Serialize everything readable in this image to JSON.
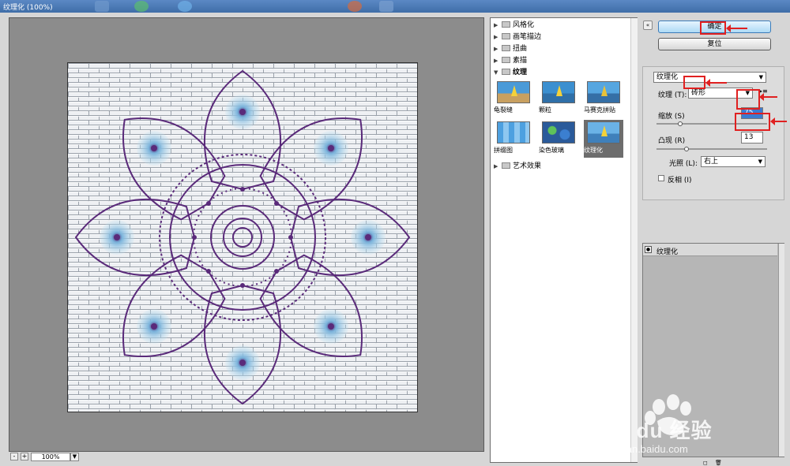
{
  "window": {
    "title": "纹理化 (100%)"
  },
  "preview": {
    "zoom": "100%",
    "minus": "-",
    "plus": "+"
  },
  "gallery": {
    "categories": [
      "风格化",
      "画笔描边",
      "扭曲",
      "素描",
      "纹理",
      "艺术效果"
    ],
    "texture_filters": [
      "龟裂缝",
      "颗粒",
      "马赛克拼贴",
      "拼缀图",
      "染色玻璃",
      "纹理化"
    ],
    "selected": "纹理化"
  },
  "settings": {
    "ok_label": "确定",
    "reset_label": "复位",
    "filter_select": "纹理化",
    "texture_label": "纹理 (T):",
    "texture_value": "砖形",
    "scaling_label": "缩放 (S)",
    "scaling_value": "75",
    "scaling_fraction": 0.2,
    "relief_label": "凸现 (R)",
    "relief_value": "13",
    "relief_fraction": 0.26,
    "light_label": "光照 (L):",
    "light_value": "右上",
    "invert_label": "反相 (I)",
    "invert_checked": false
  },
  "layers": [
    {
      "name": "纹理化"
    }
  ],
  "watermark": {
    "brand": "Bai du 经验",
    "url": "jingyan.baidu.com"
  },
  "colors": {
    "highlight": "#e02020",
    "accent": "#3b7bb9",
    "mandala": "#5a2a7a",
    "petal_fill": "#9fd4ea"
  }
}
